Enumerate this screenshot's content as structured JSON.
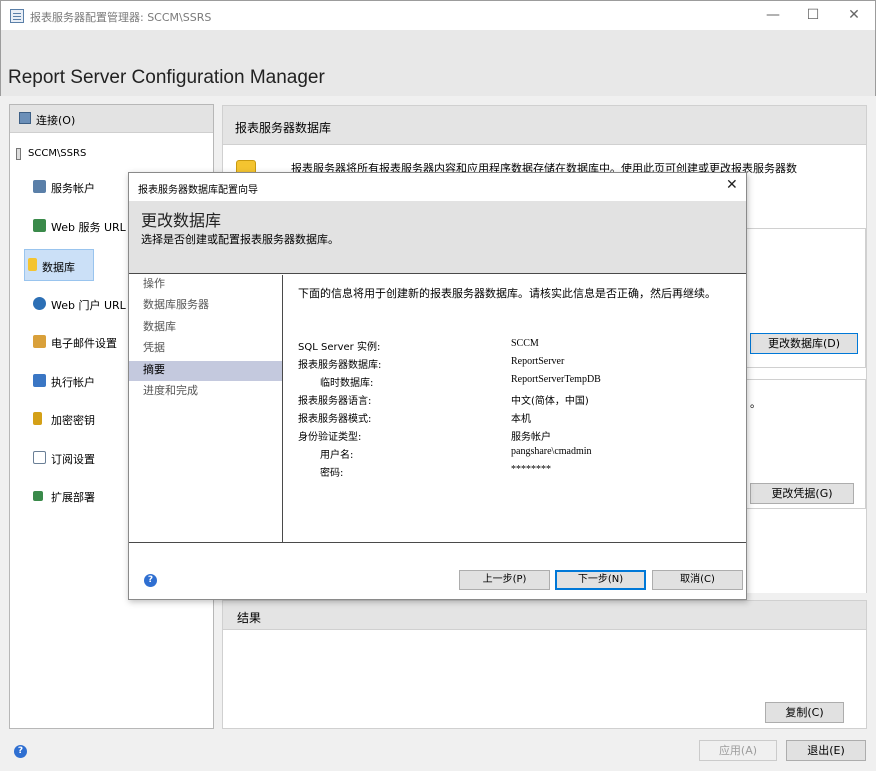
{
  "window": {
    "title": "报表服务器配置管理器: SCCM\\SSRS",
    "minimize_glyph": "—",
    "maximize_glyph": "☐",
    "close_glyph": "✕"
  },
  "header": {
    "title": "Report Server Configuration Manager"
  },
  "sidebar": {
    "connect_label": "连接(O)",
    "server_label": "SCCM\\SSRS",
    "items": [
      {
        "label": "服务帐户",
        "icon": "service-account-icon",
        "color": "#5a7fa8"
      },
      {
        "label": "Web 服务 URL",
        "icon": "web-service-icon",
        "color": "#3a8a4a"
      },
      {
        "label": "数据库",
        "icon": "database-icon",
        "color": "#f4c430"
      },
      {
        "label": "Web 门户 URL",
        "icon": "web-portal-icon",
        "color": "#2c6fb5"
      },
      {
        "label": "电子邮件设置",
        "icon": "email-icon",
        "color": "#d9a03a"
      },
      {
        "label": "执行帐户",
        "icon": "execution-account-icon",
        "color": "#3a76c4"
      },
      {
        "label": "加密密钥",
        "icon": "key-icon",
        "color": "#d4a017"
      },
      {
        "label": "订阅设置",
        "icon": "subscription-icon",
        "color": "#6a7f96"
      },
      {
        "label": "扩展部署",
        "icon": "scaleout-icon",
        "color": "#3a8a4a"
      }
    ]
  },
  "main": {
    "section_title": "报表服务器数据库",
    "description": "报表服务器将所有报表服务器内容和应用程序数据存储在数据库中。使用此页可创建或更改报表服务器数",
    "change_db_button": "更改数据库(D)",
    "box2_partial_text": "。",
    "change_cred_button": "更改凭据(G)",
    "results_title": "结果",
    "copy_button": "复制(C)",
    "apply_button": "应用(A)",
    "exit_button": "退出(E)",
    "help_glyph": "?"
  },
  "wizard": {
    "title": "报表服务器数据库配置向导",
    "close_glyph": "✕",
    "heading": "更改数据库",
    "subheading": "选择是否创建或配置报表服务器数据库。",
    "steps": [
      {
        "label": "操作",
        "selected": false
      },
      {
        "label": "数据库服务器",
        "selected": false
      },
      {
        "label": "数据库",
        "selected": false
      },
      {
        "label": "凭据",
        "selected": false
      },
      {
        "label": "摘要",
        "selected": true
      },
      {
        "label": "进度和完成",
        "selected": false
      }
    ],
    "intro": "下面的信息将用于创建新的报表服务器数据库。请核实此信息是否正确，然后再继续。",
    "summary": [
      {
        "key": "SQL Server 实例:",
        "value": "SCCM",
        "indent": false
      },
      {
        "key": "报表服务器数据库:",
        "value": "ReportServer",
        "indent": false
      },
      {
        "key": "临时数据库:",
        "value": "ReportServerTempDB",
        "indent": true
      },
      {
        "key": "报表服务器语言:",
        "value": "中文(简体，中国)",
        "indent": false
      },
      {
        "key": "报表服务器模式:",
        "value": "本机",
        "indent": false
      },
      {
        "key": "身份验证类型:",
        "value": "服务帐户",
        "indent": false
      },
      {
        "key": "用户名:",
        "value": "pangshare\\cmadmin",
        "indent": true
      },
      {
        "key": "密码:",
        "value": "********",
        "indent": true
      }
    ],
    "back_button": "上一步(P)",
    "next_button": "下一步(N)",
    "cancel_button": "取消(C)",
    "help_glyph": "?"
  }
}
